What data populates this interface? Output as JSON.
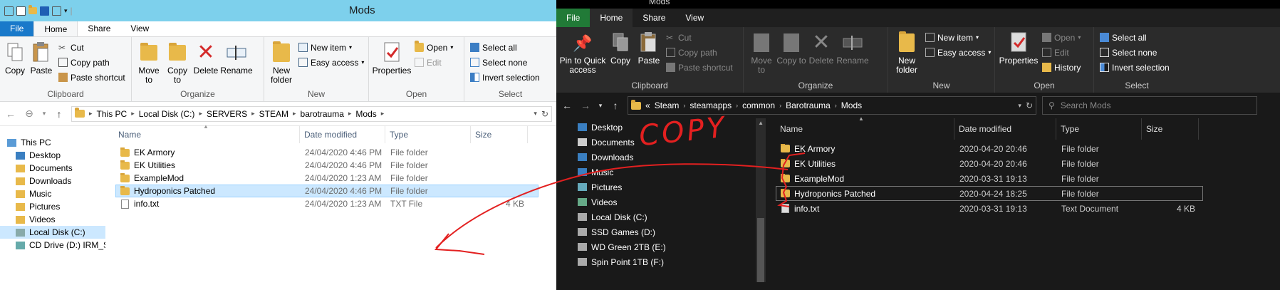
{
  "left": {
    "title": "Mods",
    "tabs": {
      "file": "File",
      "home": "Home",
      "share": "Share",
      "view": "View"
    },
    "ribbon": {
      "clipboard": {
        "label": "Clipboard",
        "copy": "Copy",
        "paste": "Paste",
        "cut": "Cut",
        "copy_path": "Copy path",
        "paste_shortcut": "Paste shortcut"
      },
      "organize": {
        "label": "Organize",
        "move_to": "Move to",
        "copy_to": "Copy to",
        "delete": "Delete",
        "rename": "Rename"
      },
      "new": {
        "label": "New",
        "new_folder": "New folder",
        "new_item": "New item",
        "easy_access": "Easy access"
      },
      "open": {
        "label": "Open",
        "properties": "Properties",
        "open": "Open",
        "edit": "Edit"
      },
      "select": {
        "label": "Select",
        "select_all": "Select all",
        "select_none": "Select none",
        "invert": "Invert selection"
      }
    },
    "path": [
      "This PC",
      "Local Disk (C:)",
      "SERVERS",
      "STEAM",
      "barotrauma",
      "Mods"
    ],
    "nav": [
      "This PC",
      "Desktop",
      "Documents",
      "Downloads",
      "Music",
      "Pictures",
      "Videos",
      "Local Disk (C:)",
      "CD Drive (D:) IRM_SS"
    ],
    "columns": {
      "name": "Name",
      "date": "Date modified",
      "type": "Type",
      "size": "Size"
    },
    "files": [
      {
        "name": "EK Armory",
        "date": "24/04/2020 4:46 PM",
        "type": "File folder",
        "size": ""
      },
      {
        "name": "EK Utilities",
        "date": "24/04/2020 4:46 PM",
        "type": "File folder",
        "size": ""
      },
      {
        "name": "ExampleMod",
        "date": "24/04/2020 1:23 AM",
        "type": "File folder",
        "size": ""
      },
      {
        "name": "Hydroponics Patched",
        "date": "24/04/2020 4:46 PM",
        "type": "File folder",
        "size": ""
      },
      {
        "name": "info.txt",
        "date": "24/04/2020 1:23 AM",
        "type": "TXT File",
        "size": "4 KB"
      }
    ]
  },
  "right": {
    "title": "Mods",
    "tabs": {
      "file": "File",
      "home": "Home",
      "share": "Share",
      "view": "View"
    },
    "ribbon": {
      "clipboard": {
        "label": "Clipboard",
        "pin": "Pin to Quick access",
        "copy": "Copy",
        "paste": "Paste",
        "cut": "Cut",
        "copy_path": "Copy path",
        "paste_shortcut": "Paste shortcut"
      },
      "organize": {
        "label": "Organize",
        "move_to": "Move to",
        "copy_to": "Copy to",
        "delete": "Delete",
        "rename": "Rename"
      },
      "new": {
        "label": "New",
        "new_folder": "New folder",
        "new_item": "New item",
        "easy_access": "Easy access"
      },
      "open": {
        "label": "Open",
        "properties": "Properties",
        "open": "Open",
        "edit": "Edit",
        "history": "History"
      },
      "select": {
        "label": "Select",
        "select_all": "Select all",
        "select_none": "Select none",
        "invert": "Invert selection"
      }
    },
    "path": [
      "steamapps",
      "common",
      "Barotrauma",
      "Mods"
    ],
    "path_prefix": "«",
    "path_root": "Steam",
    "search_placeholder": "Search Mods",
    "nav": [
      "Desktop",
      "Documents",
      "Downloads",
      "Music",
      "Pictures",
      "Videos",
      "Local Disk (C:)",
      "SSD Games (D:)",
      "WD Green 2TB (E:)",
      "Spin Point 1TB (F:)"
    ],
    "columns": {
      "name": "Name",
      "date": "Date modified",
      "type": "Type",
      "size": "Size"
    },
    "files": [
      {
        "name": "EK Armory",
        "date": "2020-04-20 20:46",
        "type": "File folder",
        "size": ""
      },
      {
        "name": "EK Utilities",
        "date": "2020-04-20 20:46",
        "type": "File folder",
        "size": ""
      },
      {
        "name": "ExampleMod",
        "date": "2020-03-31 19:13",
        "type": "File folder",
        "size": ""
      },
      {
        "name": "Hydroponics Patched",
        "date": "2020-04-24 18:25",
        "type": "File folder",
        "size": ""
      },
      {
        "name": "info.txt",
        "date": "2020-03-31 19:13",
        "type": "Text Document",
        "size": "4 KB"
      }
    ]
  },
  "annotation": {
    "text": "COPY",
    "color": "#e32020"
  }
}
